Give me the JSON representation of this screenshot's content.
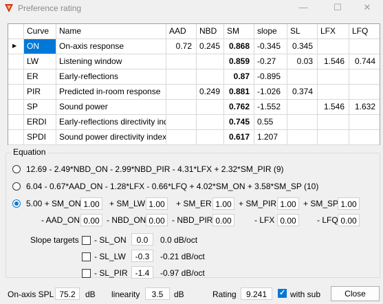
{
  "window": {
    "title": "Preference rating",
    "minimize": "—",
    "maximize": "☐",
    "close": "✕"
  },
  "table": {
    "columns": [
      "Curve",
      "Name",
      "AAD",
      "NBD",
      "SM",
      "slope",
      "SL",
      "LFX",
      "LFQ"
    ],
    "rows": [
      {
        "curve": "ON",
        "name": "On-axis response",
        "aad": "0.72",
        "nbd": "0.245",
        "sm": "0.868",
        "slope": "-0.345",
        "sl": "0.345",
        "lfx": "",
        "lfq": ""
      },
      {
        "curve": "LW",
        "name": "Listening window",
        "aad": "",
        "nbd": "",
        "sm": "0.859",
        "slope": "-0.27",
        "sl": "0.03",
        "lfx": "1.546",
        "lfq": "0.744"
      },
      {
        "curve": "ER",
        "name": "Early-reflections",
        "aad": "",
        "nbd": "",
        "sm": "0.87",
        "slope": "-0.895",
        "sl": "",
        "lfx": "",
        "lfq": ""
      },
      {
        "curve": "PIR",
        "name": "Predicted in-room response",
        "aad": "",
        "nbd": "0.249",
        "sm": "0.881",
        "slope": "-1.026",
        "sl": "0.374",
        "lfx": "",
        "lfq": ""
      },
      {
        "curve": "SP",
        "name": "Sound power",
        "aad": "",
        "nbd": "",
        "sm": "0.762",
        "slope": "-1.552",
        "sl": "",
        "lfx": "1.546",
        "lfq": "1.632"
      },
      {
        "curve": "ERDI",
        "name": "Early-reflections directivity index",
        "aad": "",
        "nbd": "",
        "sm": "0.745",
        "slope": "0.55",
        "sl": "",
        "lfx": "",
        "lfq": ""
      },
      {
        "curve": "SPDI",
        "name": "Sound power directivity index",
        "aad": "",
        "nbd": "",
        "sm": "0.617",
        "slope": "1.207",
        "sl": "",
        "lfx": "",
        "lfq": ""
      }
    ]
  },
  "equation": {
    "label": "Equation",
    "option1": "12.69 - 2.49*NBD_ON - 2.99*NBD_PIR - 4.31*LFX + 2.32*SM_PIR (9)",
    "option2": "6.04 - 0.67*AAD_ON - 1.28*LFX - 0.66*LFQ + 4.02*SM_ON + 3.58*SM_SP (10)",
    "option3_prefix": "5.00 + SM_ON",
    "sm_on": "1.00",
    "sm_lw_label": "+ SM_LW",
    "sm_lw": "1.00",
    "sm_er_label": "+ SM_ER",
    "sm_er": "1.00",
    "sm_pir_label": "+ SM_PIR",
    "sm_pir": "1.00",
    "sm_sp_label": "+ SM_SP",
    "sm_sp": "1.00",
    "aad_on_label": "- AAD_ON",
    "aad_on": "0.00",
    "nbd_on_label": "- NBD_ON",
    "nbd_on": "0.00",
    "nbd_pir_label": "- NBD_PIR",
    "nbd_pir": "0.00",
    "lfx_label": "- LFX",
    "lfx": "0.00",
    "lfq_label": "- LFQ",
    "lfq": "0.00",
    "slope_targets_label": "Slope targets",
    "sl_on_label": "- SL_ON",
    "sl_on": "0.0",
    "sl_on_text": "0.0 dB/oct",
    "sl_lw_label": "- SL_LW",
    "sl_lw": "-0.3",
    "sl_lw_text": "-0.21 dB/oct",
    "sl_pir_label": "- SL_PIR",
    "sl_pir": "-1.4",
    "sl_pir_text": "-0.97 dB/oct"
  },
  "footer": {
    "spl_label": "On-axis SPL",
    "spl": "75.2",
    "spl_unit": "dB",
    "linearity_label": "linearity",
    "linearity": "3.5",
    "linearity_unit": "dB",
    "rating_label": "Rating",
    "rating": "9.241",
    "with_sub_label": "with sub",
    "close_label": "Close"
  },
  "colors": {
    "accent": "#0078d7",
    "icon": "#d42a1f"
  }
}
